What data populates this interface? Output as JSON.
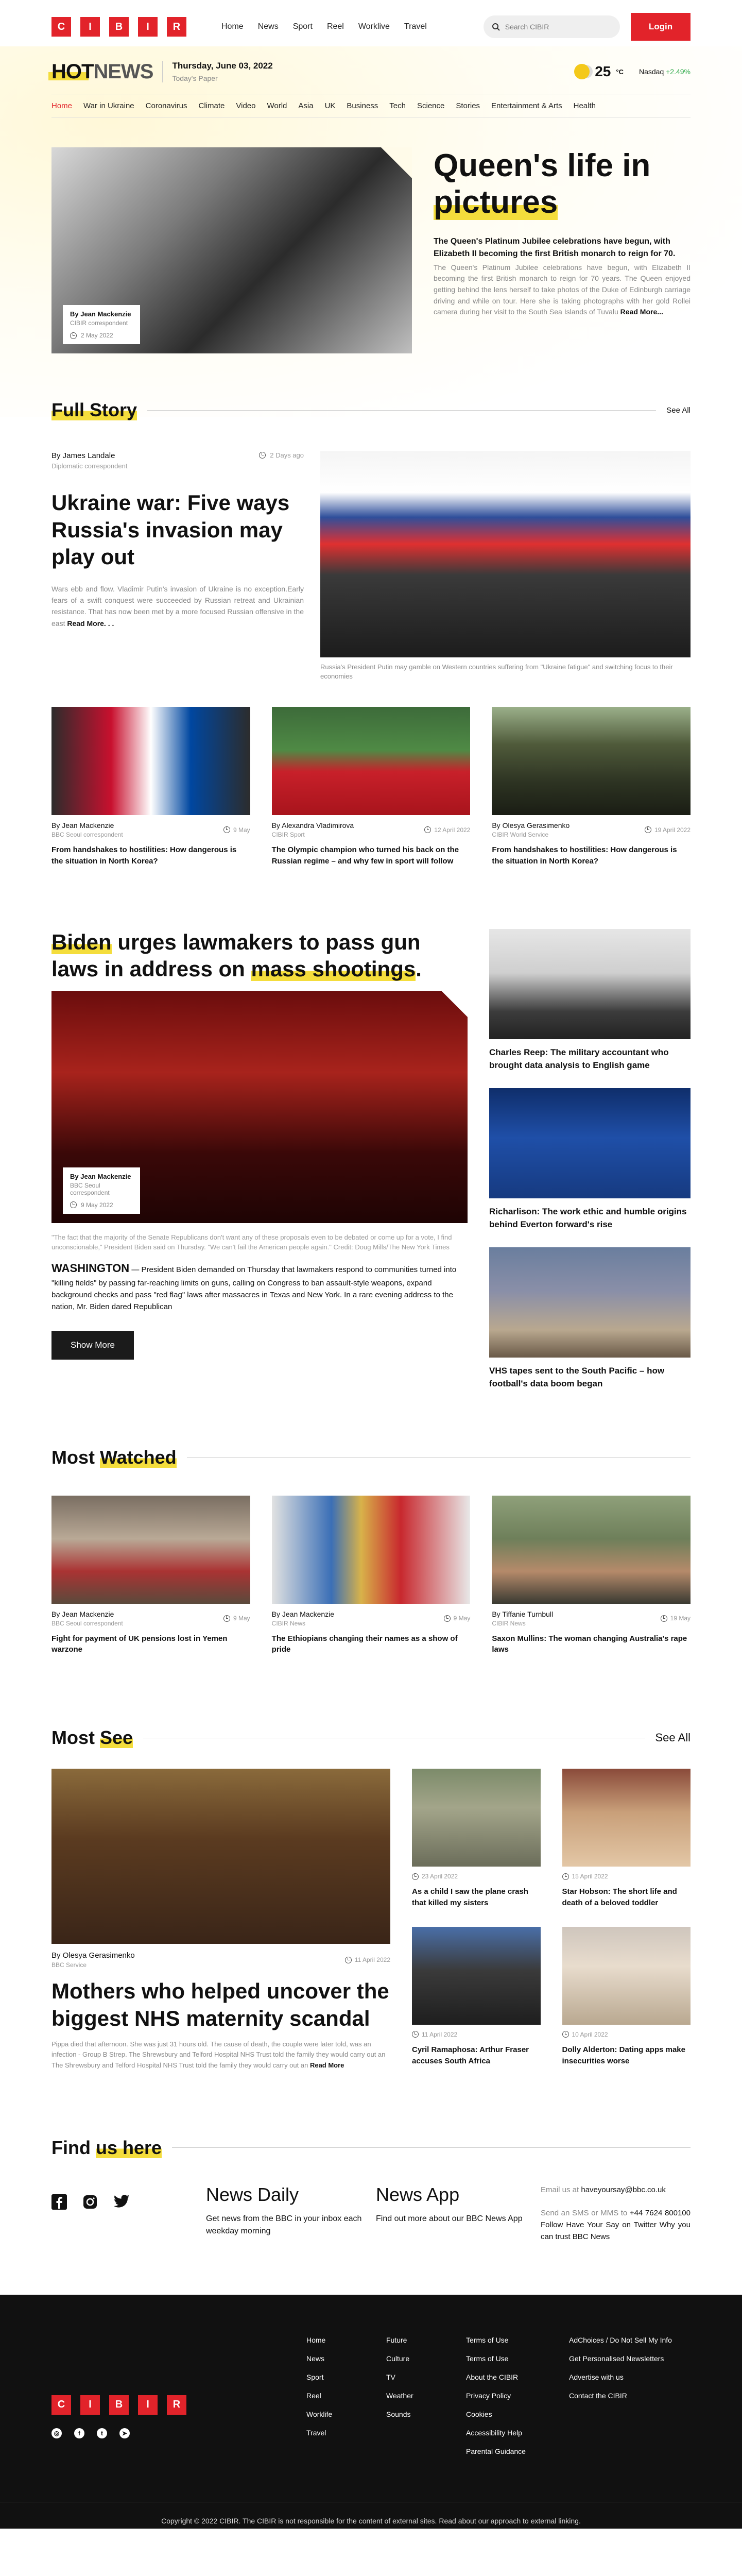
{
  "brand": {
    "letters": [
      "C",
      "I",
      "B",
      "I",
      "R"
    ]
  },
  "topnav": [
    "Home",
    "News",
    "Sport",
    "Reel",
    "Worklive",
    "Travel"
  ],
  "search": {
    "placeholder": "Search CIBIR"
  },
  "login_label": "Login",
  "header": {
    "hot": "HOT",
    "news": "NEWS",
    "date": "Thursday, June 03, 2022",
    "paper": "Today's Paper",
    "temp": "25",
    "temp_unit": "°C",
    "nasdaq_label": "Nasdaq",
    "nasdaq_change": "+2.49%"
  },
  "categories": [
    "Home",
    "War in Ukraine",
    "Coronavirus",
    "Climate",
    "Video",
    "World",
    "Asia",
    "UK",
    "Business",
    "Tech",
    "Science",
    "Stories",
    "Entertainment & Arts",
    "Health"
  ],
  "hero": {
    "author": "By Jean Mackenzie",
    "role": "CIBIR correspondent",
    "time": "2 May 2022",
    "title_a": "Queen's life in",
    "title_b": "pictures",
    "lead": "The Queen's Platinum Jubilee celebrations have begun, with Elizabeth II becoming the first British monarch to reign for 70.",
    "body": "The Queen's Platinum Jubilee celebrations have begun, with Elizabeth II becoming the first British monarch to reign for 70 years. The Queen enjoyed getting behind the lens herself to take photos of the Duke of Edinburgh carriage driving and while on tour. Here she is taking photographs with her gold Rollei camera during her visit to the South Sea Islands of Tuvalu",
    "readmore": "Read More..."
  },
  "fullstory": {
    "title": "Full Story",
    "seeall": "See All",
    "author": "By James Landale",
    "role": "Diplomatic correspondent",
    "time": "2 Days ago",
    "headline": "Ukraine war: Five ways Russia's invasion may play out",
    "body": "Wars ebb and flow. Vladimir Putin's invasion of Ukraine is no exception.Early fears of a swift conquest were succeeded by Russian retreat and Ukrainian resistance. That has now been met by a more focused Russian offensive in the east",
    "readmore": "Read More. . .",
    "caption": "Russia's President Putin may gamble on Western countries suffering from \"Ukraine fatigue\" and switching focus to their economies",
    "cards": [
      {
        "author": "By Jean Mackenzie",
        "role": "BBC Seoul correspondent",
        "time": "9 May",
        "title": "From handshakes to hostilities: How dangerous is the situation in North Korea?"
      },
      {
        "author": "By Alexandra Vladimirova",
        "role": "CIBIR Sport",
        "time": "12 April 2022",
        "title": "The Olympic champion who turned his back on the Russian regime – and why few in sport will follow"
      },
      {
        "author": "By Olesya Gerasimenko",
        "role": "CIBIR World Service",
        "time": "19 April 2022",
        "title": "From handshakes to hostilities: How dangerous is the situation in North Korea?"
      }
    ]
  },
  "biden": {
    "t1": "Biden",
    "t2": " urges lawmakers to pass gun laws in address on ",
    "t3": "mass shootings",
    "t4": ".",
    "author": "By Jean Mackenzie",
    "role": "BBC Seoul correspondent",
    "time": "9 May 2022",
    "quote": "\"The fact that the majority of the Senate Republicans don't want any of these proposals even to be debated or come up for a vote, I find unconscionable,\" President Biden said on Thursday. \"We can't fail the American people again.\" Credit: Doug Mills/The New York Times",
    "dateline": "WASHINGTON",
    "body": " — President Biden demanded on Thursday that lawmakers respond to communities turned into \"killing fields\" by passing far-reaching limits on guns, calling on Congress to ban assault-style weapons, expand background checks and pass \"red flag\" laws after massacres in Texas and New York. In a rare evening address to the nation, Mr. Biden dared Republican",
    "showmore": "Show More",
    "side": [
      {
        "title": "Charles Reep: The military accountant who brought data analysis to English game"
      },
      {
        "title": "Richarlison: The work ethic and humble origins behind Everton forward's rise"
      },
      {
        "title": "VHS tapes sent to the South Pacific – how football's data boom began"
      }
    ]
  },
  "mostwatched": {
    "title_a": "Most ",
    "title_b": "Watched",
    "cards": [
      {
        "author": "By Jean Mackenzie",
        "role": "BBC Seoul correspondent",
        "time": "9 May",
        "title": "Fight for payment of UK pensions lost in Yemen warzone"
      },
      {
        "author": "By Jean Mackenzie",
        "role": "CIBIR News",
        "time": "9 May",
        "title": "The Ethiopians changing their names as a show of pride"
      },
      {
        "author": "By Tiffanie Turnbull",
        "role": "CIBIR News",
        "time": "19 May",
        "title": "Saxon Mullins: The woman changing Australia's rape laws"
      }
    ]
  },
  "mostsee": {
    "title_a": "Most ",
    "title_b": "See",
    "seeall": "See All",
    "author": "By Olesya Gerasimenko",
    "role": "BBC Service",
    "time": "11 April 2022",
    "headline": "Mothers who helped uncover the biggest NHS maternity scandal",
    "body": "Pippa died that afternoon. She was just 31 hours old. The cause of death, the couple were later told, was an infection - Group B Strep. The Shrewsbury and Telford Hospital NHS Trust told the family they would carry out an The Shrewsbury and Telford Hospital NHS Trust told the family they would carry out an",
    "readmore": "Read More",
    "grid": [
      {
        "time": "23 April 2022",
        "title": "As a child I saw the plane crash that killed my sisters"
      },
      {
        "time": "15 April 2022",
        "title": "Star Hobson: The short life and death of a beloved toddler"
      },
      {
        "time": "11 April 2022",
        "title": "Cyril Ramaphosa: Arthur Fraser accuses South Africa"
      },
      {
        "time": "10 April 2022",
        "title": "Dolly Alderton: Dating apps make insecurities worse"
      }
    ]
  },
  "findus": {
    "title_a": "Find ",
    "title_b": "us here",
    "social_icons": [
      "facebook-icon",
      "instagram-icon",
      "twitter-icon"
    ],
    "app1_title": "News Daily",
    "app1_sub": "Get news from the BBC in your inbox each weekday morning",
    "app2_title": "News App",
    "app2_sub": "Find out more about our BBC News App",
    "email_pre": "Email us at ",
    "email": "haveyoursay@bbc.co.uk",
    "sms_pre": "Send an SMS or MMS to ",
    "sms": "+44 7624 800100",
    "follow": " Follow Have Your Say on Twitter Why you can trust BBC News"
  },
  "footer": {
    "col1": [
      "Home",
      "News",
      "Sport",
      "Reel",
      "Worklife",
      "Travel"
    ],
    "col2": [
      "Future",
      "Culture",
      "TV",
      "Weather",
      "Sounds"
    ],
    "col3": [
      "Terms of Use",
      "Terms of Use",
      "About the CIBIR",
      "Privacy Policy",
      "Cookies",
      "Accessibility Help",
      "Parental Guidance"
    ],
    "col4": [
      "AdChoices / Do Not Sell My Info",
      "Get Personalised Newsletters",
      "Advertise with us",
      "Contact the CIBIR"
    ],
    "copyright": "Copyright © 2022 CIBIR. The CIBIR is not responsible for the content of external sites. Read about our approach to external linking."
  },
  "colors": {
    "brand_red": "#e2232a",
    "highlight_yellow": "#f4dd3c",
    "gain_green": "#28a745"
  }
}
